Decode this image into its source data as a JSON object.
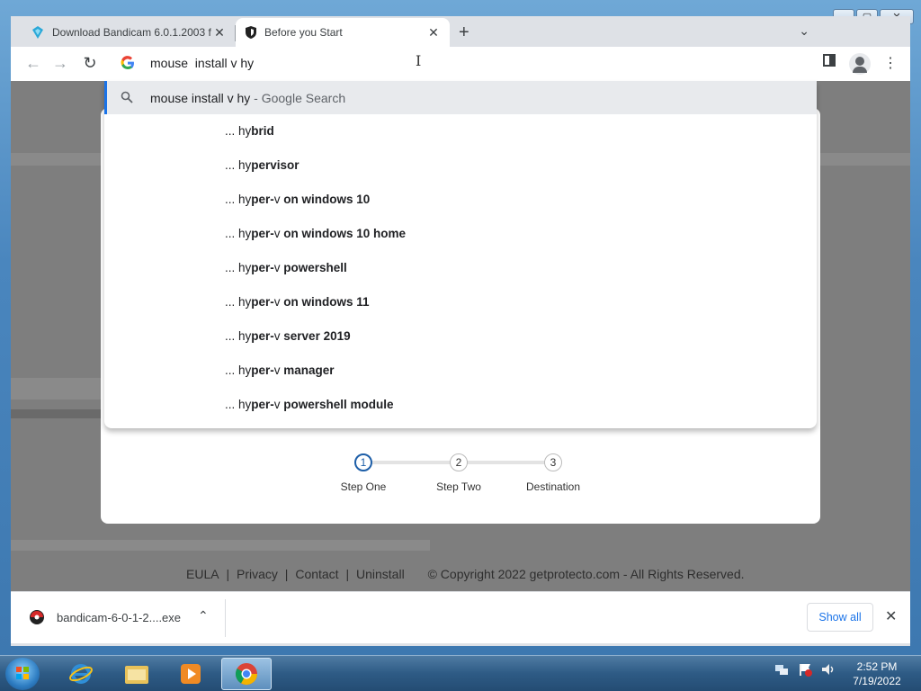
{
  "browser": {
    "tabs": [
      {
        "title": "Download Bandicam 6.0.1.2003 f",
        "close": "✕"
      },
      {
        "title": "Before you Start",
        "close": "✕"
      }
    ],
    "new_tab": "+",
    "tab_search": "⌄"
  },
  "omnibox": {
    "value": "mouse  install v hy",
    "suggestions_top": {
      "query": "mouse install v hy",
      "suffix": " - Google Search"
    },
    "suggestions": [
      {
        "prefix": "... hy",
        "rest_plain": "",
        "bold": "brid",
        "rest": ""
      },
      {
        "prefix": "... hy",
        "rest_plain": "",
        "bold": "pervisor",
        "rest": ""
      },
      {
        "prefix": "... hy",
        "bold": "per-",
        "rest_plain": "v",
        "rest": " on windows 10"
      },
      {
        "prefix": "... hy",
        "bold": "per-",
        "rest_plain": "v",
        "rest": " on windows 10 home"
      },
      {
        "prefix": "... hy",
        "bold": "per-",
        "rest_plain": "v",
        "rest": " powershell"
      },
      {
        "prefix": "... hy",
        "bold": "per-",
        "rest_plain": "v",
        "rest": " on windows 11"
      },
      {
        "prefix": "... hy",
        "bold": "per-",
        "rest_plain": "v",
        "rest": " server 2019"
      },
      {
        "prefix": "... hy",
        "bold": "per-",
        "rest_plain": "v",
        "rest": " manager"
      },
      {
        "prefix": "... hy",
        "bold": "per-",
        "rest_plain": "v",
        "rest": " powershell module"
      }
    ]
  },
  "page": {
    "steps": [
      {
        "num": "1",
        "label": "Step One"
      },
      {
        "num": "2",
        "label": "Step Two"
      },
      {
        "num": "3",
        "label": "Destination"
      }
    ],
    "footer": {
      "eula": "EULA",
      "privacy": "Privacy",
      "contact": "Contact",
      "uninstall": "Uninstall",
      "sep": "|",
      "copyright": "© Copyright 2022 getprotecto.com - All Rights Reserved."
    }
  },
  "downloads": {
    "filename": "bandicam-6-0-1-2....exe",
    "show_all": "Show all",
    "close": "✕"
  },
  "taskbar": {
    "time": "2:52 PM",
    "date": "7/19/2022"
  },
  "colors": {
    "accent": "#1a73e8",
    "step_active": "#1e5fa8"
  }
}
